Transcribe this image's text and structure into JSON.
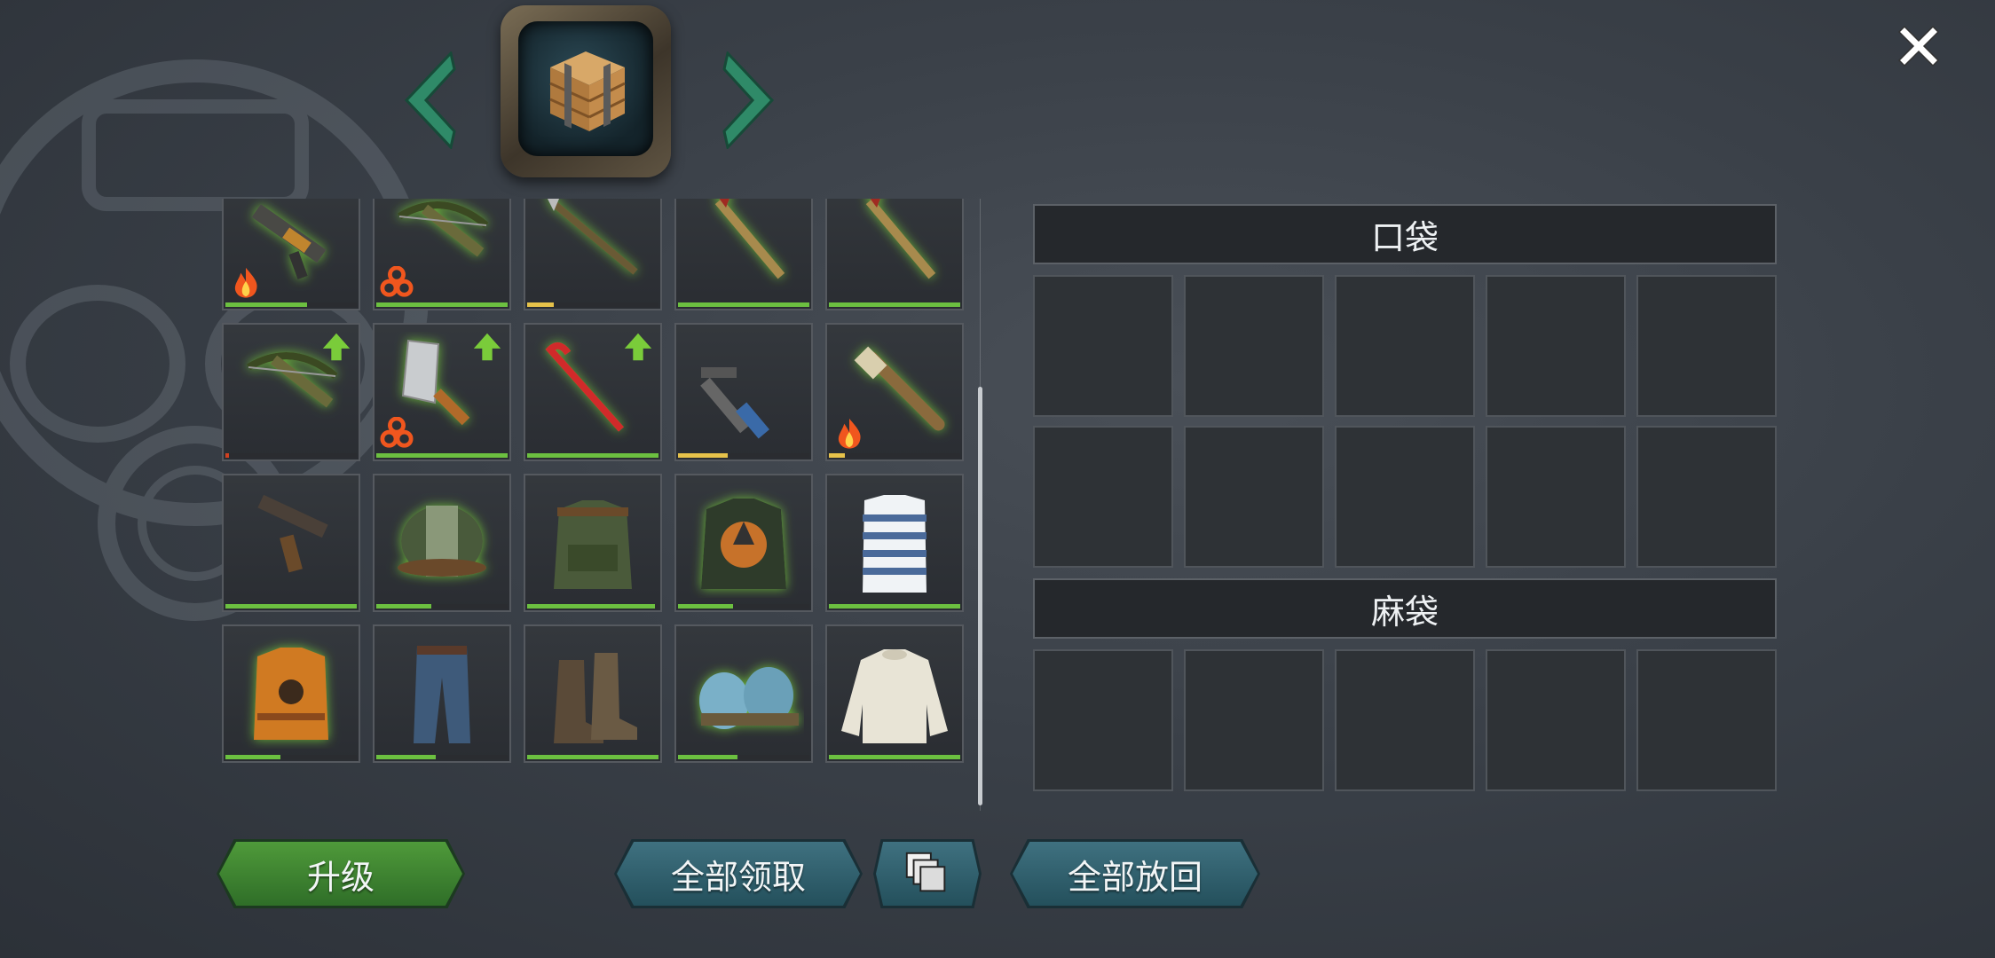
{
  "header": {
    "prev_icon": "chevron-left-icon",
    "next_icon": "chevron-right-icon",
    "container_icon": "wooden-crate-icon",
    "close_icon": "close-icon"
  },
  "inventory": {
    "slots": [
      {
        "item": "assault-rifle",
        "badge": "fire",
        "durability": 0.62,
        "color": "#6cc040"
      },
      {
        "item": "crossbow",
        "badge": "biohazard",
        "durability": 1.0,
        "color": "#6cc040"
      },
      {
        "item": "spear",
        "badge": "",
        "durability": 0.2,
        "color": "#e6c24a"
      },
      {
        "item": "axe",
        "badge": "",
        "durability": 1.0,
        "color": "#6cc040"
      },
      {
        "item": "axe",
        "badge": "",
        "durability": 1.0,
        "color": "#6cc040"
      },
      {
        "item": "crossbow",
        "badge": "upgrade",
        "durability": 0.03,
        "color": "#d04020"
      },
      {
        "item": "cleaver",
        "badge": "upgrade-biohazard",
        "durability": 1.0,
        "color": "#6cc040"
      },
      {
        "item": "crowbar",
        "badge": "upgrade",
        "durability": 1.0,
        "color": "#6cc040"
      },
      {
        "item": "pipe-wrench",
        "badge": "",
        "durability": 0.38,
        "color": "#e6c24a"
      },
      {
        "item": "spiked-bat",
        "badge": "fire",
        "durability": 0.12,
        "color": "#e6c24a"
      },
      {
        "item": "pistol",
        "badge": "",
        "durability": 1.0,
        "color": "#6cc040"
      },
      {
        "item": "bandana-helmet",
        "badge": "",
        "durability": 0.42,
        "color": "#6cc040"
      },
      {
        "item": "tactical-vest",
        "badge": "",
        "durability": 0.97,
        "color": "#6cc040"
      },
      {
        "item": "armored-jacket",
        "badge": "",
        "durability": 0.42,
        "color": "#6cc040"
      },
      {
        "item": "striped-shirt",
        "badge": "",
        "durability": 1.0,
        "color": "#6cc040"
      },
      {
        "item": "radiation-vest",
        "badge": "",
        "durability": 0.42,
        "color": "#6cc040"
      },
      {
        "item": "jeans",
        "badge": "",
        "durability": 0.45,
        "color": "#6cc040"
      },
      {
        "item": "boots",
        "badge": "",
        "durability": 1.0,
        "color": "#6cc040"
      },
      {
        "item": "slippers",
        "badge": "",
        "durability": 0.45,
        "color": "#6cc040"
      },
      {
        "item": "sweater",
        "badge": "",
        "durability": 1.0,
        "color": "#6cc040"
      }
    ]
  },
  "container": {
    "pocket_title": "口袋",
    "sack_title": "麻袋"
  },
  "buttons": {
    "upgrade": "升级",
    "take_all": "全部领取",
    "stack_icon": "stack-icon",
    "put_back_all": "全部放回"
  }
}
